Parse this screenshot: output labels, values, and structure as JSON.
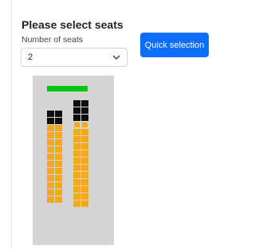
{
  "panel": {
    "title": "Please select seats",
    "seat_count_label": "Number of seats",
    "seat_count_value": "2",
    "quick_selection_label": "Quick selection"
  },
  "seatmap": {
    "colors": {
      "background": "#d4d4d4",
      "screen": "#08c40f",
      "occupied": "#0d0d0d",
      "available": "#f2a91b"
    },
    "left_block": {
      "rows": [
        [
          "occupied",
          "occupied"
        ],
        [
          "occupied",
          "occupied"
        ],
        [
          "available",
          "available"
        ],
        [
          "available",
          "available"
        ],
        [
          "available",
          "available"
        ],
        [
          "available",
          "available"
        ],
        [
          "available",
          "available"
        ],
        [
          "available",
          "available"
        ],
        [
          "available",
          "available"
        ],
        [
          "available",
          "available"
        ],
        [
          "available",
          "available"
        ],
        [
          "available",
          "available"
        ],
        [
          "available",
          "available"
        ]
      ]
    },
    "right_block": {
      "rows": [
        [
          "occupied",
          "occupied"
        ],
        [
          "occupied",
          "occupied"
        ],
        [
          "occupied",
          "occupied"
        ],
        [
          "selected",
          "selected"
        ],
        [
          "available",
          "available"
        ],
        [
          "available",
          "available"
        ],
        [
          "available",
          "available"
        ],
        [
          "available",
          "available"
        ],
        [
          "available",
          "available"
        ],
        [
          "available",
          "available"
        ],
        [
          "available",
          "available"
        ],
        [
          "available",
          "available"
        ],
        [
          "available",
          "available"
        ],
        [
          "available",
          "available"
        ],
        [
          "available",
          "available"
        ]
      ]
    }
  }
}
